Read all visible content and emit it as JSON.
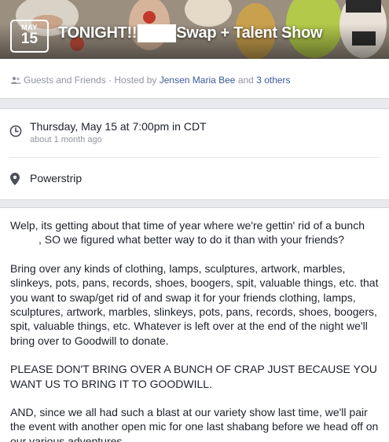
{
  "cover": {
    "month": "MAY",
    "day": "15",
    "title_part1": "TONIGHT!!",
    "title_part2": "Swap + Talent Show"
  },
  "host": {
    "privacy": "Guests and Friends",
    "separator": " · Hosted by ",
    "host_name": "Jensen Maria Bee",
    "and_text": " and ",
    "others_link": "3 others"
  },
  "details": {
    "time_main": "Thursday, May 15 at 7:00pm in CDT",
    "time_relative": "about 1 month ago",
    "location": "Powerstrip"
  },
  "description": {
    "p1_start": "Welp, its getting about that time of year where we're gettin' rid of a bunch",
    "p1_end": ", SO we figured what better way to do it than with your friends?",
    "p2": "Bring over any kinds of clothing, lamps, sculptures, artwork, marbles, slinkeys, pots, pans, records, shoes, boogers, spit, valuable things, etc. that you want to swap/get rid of and swap it for your friends clothing, lamps, sculptures, artwork, marbles, slinkeys, pots, pans, records, shoes, boogers, spit, valuable things, etc. Whatever is left over at the end of the night we'll bring over to Goodwill to donate.",
    "p3": "PLEASE DON'T BRING OVER A BUNCH OF CRAP JUST BECAUSE YOU WANT US TO BRING IT TO GOODWILL.",
    "p4": "AND, since we all had such a blast at our variety show last time, we'll pair the event with another open mic for one last shabang before we head off on our various adventures."
  },
  "colors": {
    "link": "#3b5998",
    "muted": "#90949c",
    "text": "#1d2129",
    "page_bg": "#e9eaed"
  },
  "icons": {
    "privacy": "people-icon",
    "time": "clock-icon",
    "location": "map-pin-icon"
  }
}
